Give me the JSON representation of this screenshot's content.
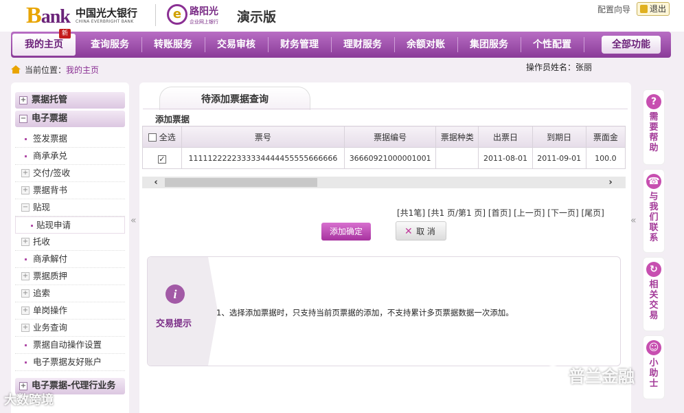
{
  "header": {
    "logo_bank": "Bank",
    "logo_cn": "中国光大银行",
    "logo_en": "CHINA EVERBRIGHT BANK",
    "ygg_title": "路阳光",
    "ygg_sub": "企业网上银行",
    "demo_label": "演示版",
    "config_link": "配置向导",
    "logout": "退出"
  },
  "nav": {
    "items": [
      "我的主页",
      "查询服务",
      "转账服务",
      "交易审核",
      "财务管理",
      "理财服务",
      "余额对账",
      "集团服务",
      "个性配置"
    ],
    "new_badge": "新",
    "all_functions": "全部功能"
  },
  "breadcrumb": {
    "prefix": "当前位置：",
    "current": "我的主页"
  },
  "operator": "操作员姓名：张丽",
  "sidebar": {
    "sections": [
      {
        "label": "票据托管",
        "toggle": "+"
      },
      {
        "label": "电子票据",
        "toggle": "−"
      }
    ],
    "items": [
      {
        "label": "签发票据",
        "kind": "dot"
      },
      {
        "label": "商承承兑",
        "kind": "dot"
      },
      {
        "label": "交付/签收",
        "kind": "box"
      },
      {
        "label": "票据背书",
        "kind": "box"
      },
      {
        "label": "贴现",
        "kind": "boxminus"
      },
      {
        "label": "贴现申请",
        "kind": "active"
      },
      {
        "label": "托收",
        "kind": "box"
      },
      {
        "label": "商承解付",
        "kind": "dot"
      },
      {
        "label": "票据质押",
        "kind": "box"
      },
      {
        "label": "追索",
        "kind": "box"
      },
      {
        "label": "单岗操作",
        "kind": "box"
      },
      {
        "label": "业务查询",
        "kind": "box"
      },
      {
        "label": "票据自动操作设置",
        "kind": "dot"
      },
      {
        "label": "电子票据友好账户",
        "kind": "dot"
      }
    ],
    "bottom_section": "电子票据-代理行业务"
  },
  "main": {
    "tab_title": "待添加票据查询",
    "section_title": "添加票据",
    "table": {
      "headers": [
        "全选",
        "票号",
        "票据编号",
        "票据种类",
        "出票日",
        "到期日",
        "票面金"
      ],
      "rows": [
        [
          "",
          "1111122222333334444455555666666",
          "36660921000001001",
          "",
          "2011-08-01",
          "2011-09-01",
          "100.0"
        ]
      ]
    },
    "pager": "[共1笔] [共1 页/第1 页] [首页] [上一页] [下一页] [尾页]",
    "confirm_button": "添加确定",
    "cancel_button": "取 消",
    "tip_label": "交易提示",
    "tip_text": "1、选择添加票据时，只支持当前页票据的添加，不支持累计多页票据数据一次添加。"
  },
  "right_panel": [
    {
      "icon": "?",
      "text": "需要帮助"
    },
    {
      "icon": "☎",
      "text": "与我们联系"
    },
    {
      "icon": "↻",
      "text": "相关交易"
    },
    {
      "icon": "☺",
      "text": "小助士"
    }
  ],
  "watermarks": {
    "right": "普兰金融",
    "left": "大数跨境"
  },
  "colors": {
    "brand_purple": "#8a3b98",
    "accent_pink": "#c74fb0",
    "logo_gold": "#e8a400"
  }
}
